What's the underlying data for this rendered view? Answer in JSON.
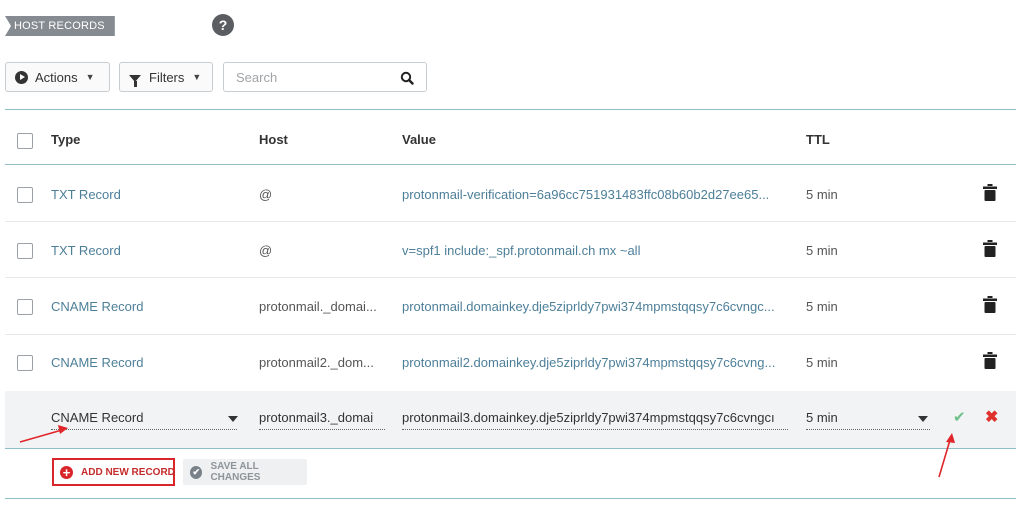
{
  "section": {
    "title": "HOST RECORDS",
    "help_icon": "?"
  },
  "toolbar": {
    "actions_label": "Actions",
    "filters_label": "Filters",
    "search_placeholder": "Search"
  },
  "table": {
    "columns": {
      "type": "Type",
      "host": "Host",
      "value": "Value",
      "ttl": "TTL"
    },
    "rows": [
      {
        "type": "TXT Record",
        "host": "@",
        "value": "protonmail-verification=6a96cc751931483ffc08b60b2d27ee65...",
        "ttl": "5 min"
      },
      {
        "type": "TXT Record",
        "host": "@",
        "value": "v=spf1 include:_spf.protonmail.ch mx ~all",
        "ttl": "5 min"
      },
      {
        "type": "CNAME Record",
        "host": "protonmail._domai...",
        "value": "protonmail.domainkey.dje5ziprldy7pwi374mpmstqqsy7c6cvngc...",
        "ttl": "5 min"
      },
      {
        "type": "CNAME Record",
        "host": "protonmail2._dom...",
        "value": "protonmail2.domainkey.dje5ziprldy7pwi374mpmstqqsy7c6cvng...",
        "ttl": "5 min"
      }
    ],
    "edit_row": {
      "type": "CNAME Record",
      "host": "protonmail3._domai",
      "value": "protonmail3.domainkey.dje5ziprldy7pwi374mpmstqqsy7c6cvngcı",
      "ttl": "5 min"
    }
  },
  "footer": {
    "add_label": "ADD NEW RECORD",
    "save_label": "SAVE ALL CHANGES"
  },
  "icons": {
    "trash": "trash-icon",
    "check": "checkmark-icon",
    "close": "close-icon",
    "search": "search-icon",
    "actions": "play-circle-icon",
    "filters": "funnel-icon"
  },
  "colors": {
    "accent_link": "#4d7f99",
    "rule": "#8fbfc4",
    "danger": "#d9262b",
    "confirm": "#6fbf8a"
  }
}
